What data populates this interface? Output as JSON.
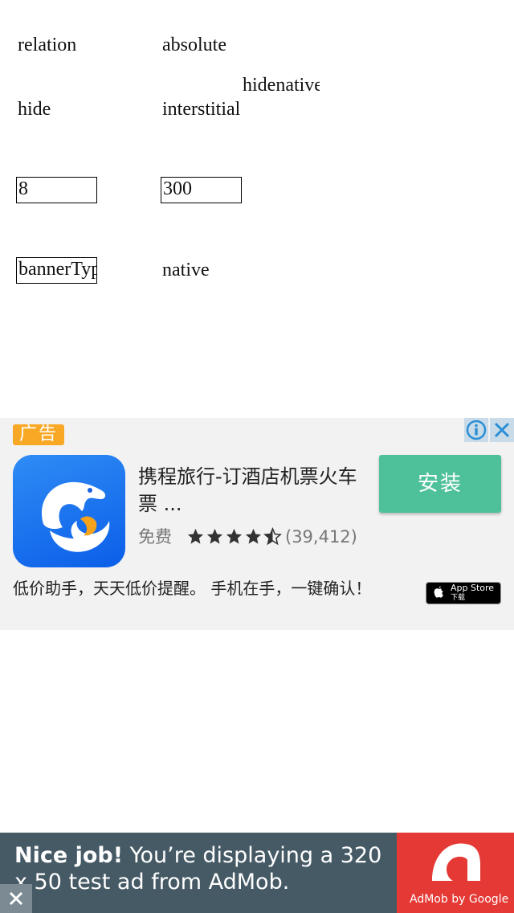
{
  "form": {
    "relation_label": "relation",
    "absolute_label": "absolute",
    "hidenative_label": "hidenative",
    "hide_label": "hide",
    "interstitial_label": "interstitial",
    "field_one_value": "8",
    "field_two_value": "300",
    "banner_type_value": "bannerTyp",
    "native_label": "native"
  },
  "native_ad": {
    "badge": "广告",
    "app_title": "携程旅行-订酒店机票火车票 ...",
    "price": "免费",
    "rating_stars": 4.5,
    "rating_count": "(39,412)",
    "install_label": "安装",
    "description": "低价助手，天天低价提醒。 手机在手，一键确认！",
    "app_store_line1": "App Store",
    "app_store_line2": "下载",
    "colors": {
      "install": "#4fc19a",
      "badge": "#f9a825",
      "icon": "#1a73f0"
    }
  },
  "banner": {
    "bold": "Nice job!",
    "text": " You’re displaying a 320 x 50 test ad from AdMob.",
    "brand": "AdMob by Google",
    "colors": {
      "background": "#465a66",
      "logo_bg": "#e53935"
    }
  }
}
